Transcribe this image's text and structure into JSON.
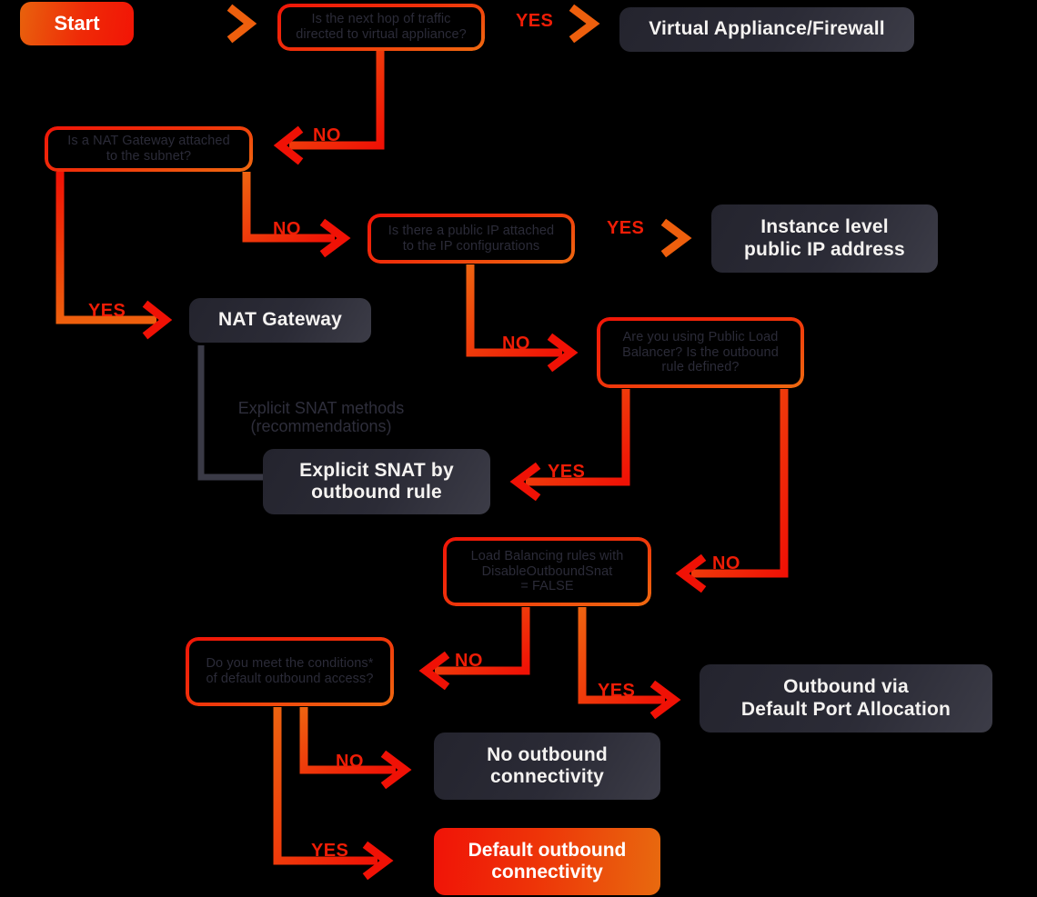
{
  "diagram": {
    "title": "Azure outbound connectivity decision flowchart",
    "background": "#000000",
    "accent_start": "#ef2a07",
    "accent_line": "#ef3408",
    "result_bg": "#2b2b36",
    "decision_text_color": "#2b2b38",
    "label_color": "#ef1d06"
  },
  "nodes": {
    "start": {
      "label": "Start",
      "type": "start"
    },
    "q_next_hop": {
      "label": "Is the next hop of traffic\ndirected to virtual appliance?",
      "type": "decision"
    },
    "virtual_appliance": {
      "label": "Virtual Appliance/Firewall",
      "type": "result"
    },
    "q_nat_gateway": {
      "label": "Is a NAT Gateway attached\nto the subnet?",
      "type": "decision"
    },
    "q_public_ip": {
      "label": "Is there a public IP attached\nto the IP configurations",
      "type": "decision"
    },
    "instance_public_ip": {
      "label": "Instance level\npublic IP address",
      "type": "result"
    },
    "nat_gateway": {
      "label": "NAT Gateway",
      "type": "result"
    },
    "q_public_lb": {
      "label": "Are you using Public Load\nBalancer? Is the outbound\nrule defined?",
      "type": "decision"
    },
    "explicit_snat": {
      "label": "Explicit SNAT by\noutbound rule",
      "type": "result"
    },
    "lb_rules": {
      "label": "Load Balancing rules with\nDisableOutboundSnat\n= FALSE",
      "type": "decision"
    },
    "q_default_outbound": {
      "label": "Do you meet the conditions*\nof default outbound access?",
      "type": "decision"
    },
    "outbound_default_port": {
      "label": "Outbound via\nDefault Port Allocation",
      "type": "result"
    },
    "no_outbound": {
      "label": "No outbound\nconnectivity",
      "type": "result"
    },
    "default_outbound": {
      "label": "Default outbound\nconnectivity",
      "type": "accent-end"
    }
  },
  "caption": {
    "explicit_snat_methods": "Explicit SNAT methods\n(recommendations)"
  },
  "edge_labels": {
    "next_hop_yes": "YES",
    "next_hop_no": "NO",
    "nat_gateway_yes": "YES",
    "nat_gateway_no": "NO",
    "public_ip_yes": "YES",
    "public_ip_no": "NO",
    "public_lb_yes": "YES",
    "public_lb_no": "NO",
    "lb_rules_no": "NO",
    "lb_rules_yes": "YES",
    "default_outbound_no": "NO",
    "default_outbound_yes": "YES"
  }
}
